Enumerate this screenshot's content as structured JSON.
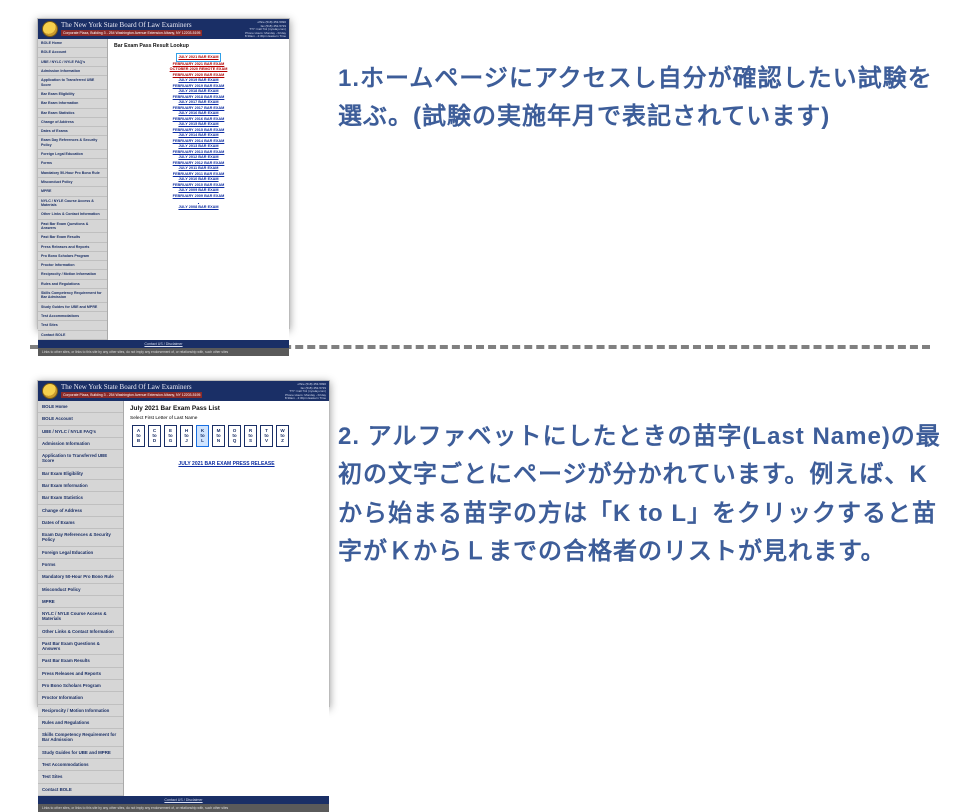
{
  "instructions": {
    "step1": "1.ホームページにアクセスし自分が確認したい試験を選ぶ。(試験の実施年月で表記されています)",
    "step2": "2. アルファベットにしたときの苗字(Last Name)の最初の文字ごとにページが分かれています。例えば、Kから始まる苗字の方は「K to L」をクリックすると苗字がＫからＬまでの合格者のリストが見れます。"
  },
  "header": {
    "title": "The New York State Board Of Law Examiners",
    "sub": "Corporate Plaza, Building 3 - 254 Washington Avenue Extension Albany, NY 12203-5195",
    "right": [
      "office (518) 453-5990",
      "fax (518) 452-5729",
      "TTY: Call 711 (nyrelay.com)",
      "Phone Hours: Monday - Friday",
      "8:30am - 4:30pm Eastern Time"
    ]
  },
  "sidebar": [
    "BOLE Home",
    "BOLE Account",
    "UBE / NYLC / NYLE FAQ's",
    "Admission Information",
    "Application to Transferred UBE Score",
    "Bar Exam Eligibility",
    "Bar Exam Information",
    "Bar Exam Statistics",
    "Change of Address",
    "Dates of Exams",
    "Exam Day References & Security Policy",
    "Foreign Legal Education",
    "Forms",
    "Mandatory 50-Hour Pro Bono Rule",
    "Misconduct Policy",
    "MPRE",
    "NYLC / NYLE Course Access & Materials",
    "Other Links & Contact Information",
    "Past Bar Exam Questions & Answers",
    "Past Bar Exam Results",
    "Press Releases and Reports",
    "Pro Bono Scholars Program",
    "Proctor Information",
    "Reciprocity / Motion Information",
    "Rules and Regulations",
    "Skills Competency Requirement for Bar Admission",
    "Study Guides for UBE and MPRE",
    "Test Accommodations",
    "Test Sites",
    "Contact BOLE"
  ],
  "panel1": {
    "heading": "Bar Exam Pass Result Lookup",
    "highlighted": "JULY 2021 BAR EXAM",
    "exams": [
      {
        "t": "FEBRUARY 2021 BAR EXAM",
        "hot": true
      },
      {
        "t": "OCTOBER 2020 REMOTE EXAM",
        "hot": true
      },
      {
        "t": "FEBRUARY 2020 BAR EXAM",
        "hot": true
      },
      {
        "t": "JULY 2019 BAR EXAM"
      },
      {
        "t": "FEBRUARY 2019 BAR EXAM"
      },
      {
        "t": "JULY 2018 BAR EXAM"
      },
      {
        "t": "FEBRUARY 2018 BAR EXAM"
      },
      {
        "t": "JULY 2017 BAR EXAM"
      },
      {
        "t": "FEBRUARY 2017 BAR EXAM"
      },
      {
        "t": "JULY 2016 BAR EXAM"
      },
      {
        "t": "FEBRUARY 2016 BAR EXAM"
      },
      {
        "t": "JULY 2015 BAR EXAM"
      },
      {
        "t": "FEBRUARY 2015 BAR EXAM"
      },
      {
        "t": "JULY 2014 BAR EXAM"
      },
      {
        "t": "FEBRUARY 2014 BAR EXAM"
      },
      {
        "t": "JULY 2013 BAR EXAM"
      },
      {
        "t": "FEBRUARY 2013 BAR EXAM"
      },
      {
        "t": "JULY 2012 BAR EXAM"
      },
      {
        "t": "FEBRUARY 2012 BAR EXAM"
      },
      {
        "t": "JULY 2011 BAR EXAM"
      },
      {
        "t": "FEBRUARY 2011 BAR EXAM"
      },
      {
        "t": "JULY 2010 BAR EXAM"
      },
      {
        "t": "FEBRUARY 2010 BAR EXAM"
      },
      {
        "t": "JULY 2009 BAR EXAM"
      },
      {
        "t": "FEBRUARY 2009 BAR EXAM"
      },
      {
        "t": ""
      },
      {
        "t": "JULY 2008 BAR EXAM"
      }
    ]
  },
  "panel2": {
    "heading": "July 2021 Bar Exam Pass List",
    "hint": "Select First Letter of Last Name",
    "letters": [
      {
        "t": "A to B"
      },
      {
        "t": "C to D"
      },
      {
        "t": "E to G"
      },
      {
        "t": "H to J"
      },
      {
        "t": "K to L",
        "sel": true
      },
      {
        "t": "M to N"
      },
      {
        "t": "O to Q"
      },
      {
        "t": "R to S"
      },
      {
        "t": "T to V"
      },
      {
        "t": "W to Z"
      }
    ],
    "press": "JULY 2021 BAR EXAM PRESS RELEASE"
  },
  "footer": {
    "links": "Contact US / Disclaimer",
    "note": "Links to other sites, or links to this site by any other sites, do not imply any endorsement of, or relationship with, such other sites"
  }
}
